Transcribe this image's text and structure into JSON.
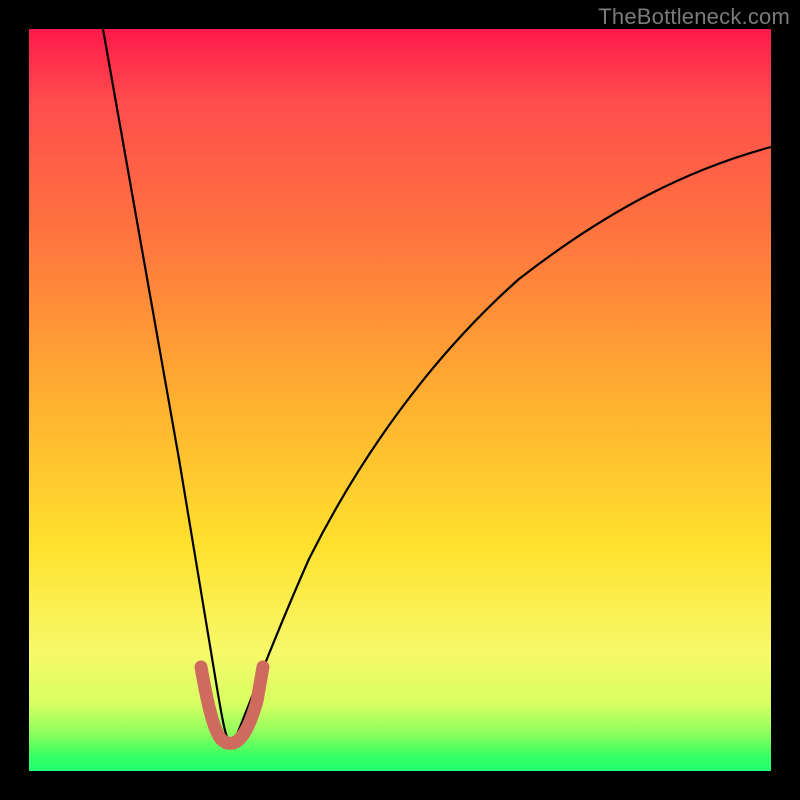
{
  "watermark": "TheBottleneck.com",
  "chart_data": {
    "type": "line",
    "title": "",
    "xlabel": "",
    "ylabel": "",
    "xlim": [
      0,
      100
    ],
    "ylim": [
      0,
      100
    ],
    "grid": false,
    "legend": false,
    "curve_black": {
      "name": "bottleneck-curve",
      "color": "#000000",
      "x": [
        10,
        12,
        14,
        16,
        18,
        20,
        22,
        24,
        25,
        26.5,
        28,
        30,
        33,
        38,
        44,
        52,
        60,
        70,
        80,
        90,
        100
      ],
      "y": [
        100,
        87,
        73,
        60,
        47,
        34,
        22,
        12,
        7,
        4.5,
        7,
        12,
        20,
        32,
        44,
        56,
        66,
        76,
        83,
        88,
        91
      ]
    },
    "highlight_valley": {
      "name": "optimal-range",
      "color": "#d16a61",
      "x": [
        23.3,
        24.2,
        25.0,
        25.8,
        26.6,
        27.6,
        28.5,
        29.4
      ],
      "y": [
        14.0,
        8.0,
        5.0,
        4.2,
        4.2,
        5.0,
        8.0,
        14.0
      ]
    }
  }
}
